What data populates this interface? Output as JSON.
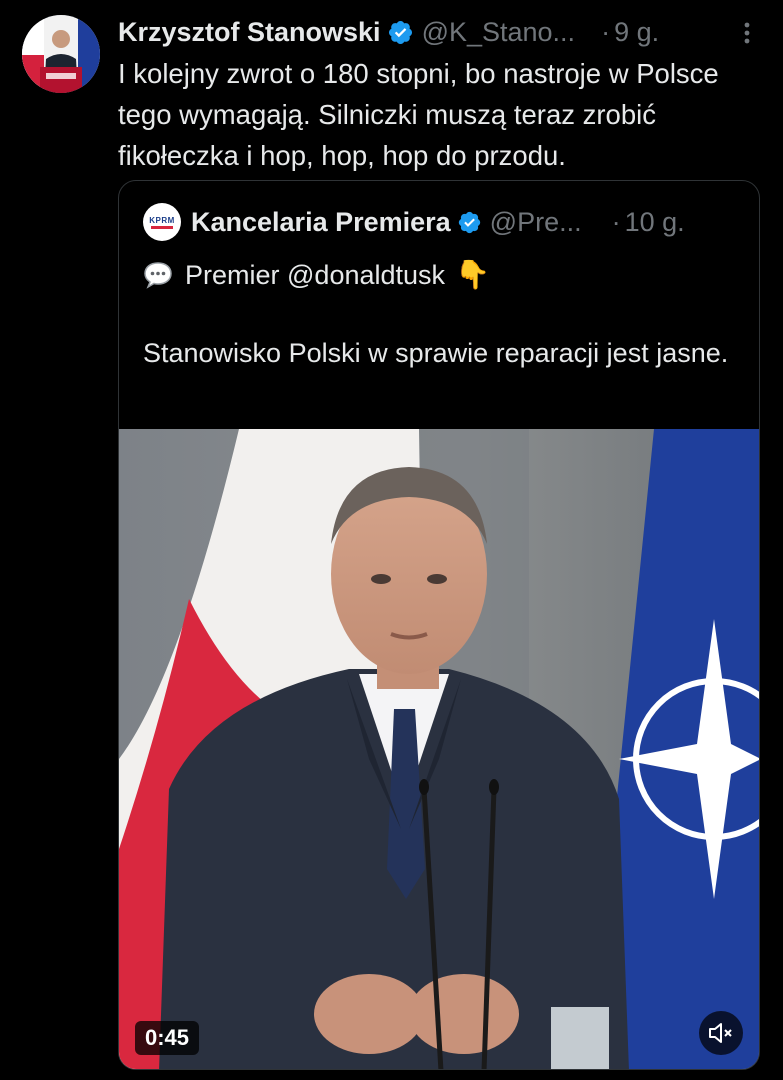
{
  "tweet": {
    "author": {
      "display_name": "Krzysztof Stanowski",
      "handle": "@K_Stano...",
      "time": "9 g.",
      "dot": "·"
    },
    "text": "I kolejny zwrot o 180 stopni, bo nastroje w Polsce tego wymagają. Silniczki muszą teraz zrobić fikołeczka i hop, hop, hop do przodu."
  },
  "quote": {
    "author": {
      "logo_text": "KPRM",
      "display_name": "Kancelaria Premiera",
      "handle": "@Pre...",
      "time": "10 g.",
      "dot": "·"
    },
    "line1": "Premier @donaldtusk",
    "line1_emoji": "👇",
    "line2": "Stanowisko Polski w sprawie reparacji jest jasne.",
    "video": {
      "duration": "0:45"
    }
  },
  "icons": {
    "verified": "verified-badge-icon",
    "more": "more-dots-icon",
    "speech": "speech-bubble-icon",
    "mute": "mute-icon"
  },
  "colors": {
    "background": "#000000",
    "text": "#e7e9ea",
    "secondary": "#71767b",
    "verified": "#1d9bf0",
    "border": "#2f3336"
  }
}
